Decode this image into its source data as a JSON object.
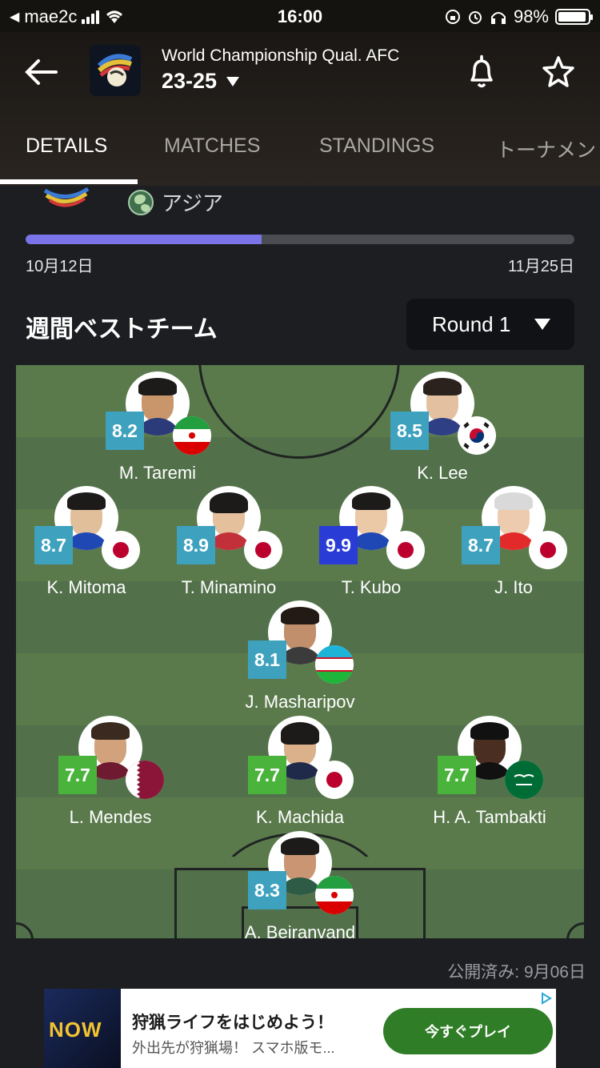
{
  "status_bar": {
    "carrier": "mae2c",
    "time": "16:00",
    "battery": "98%"
  },
  "header": {
    "competition": "World Championship Qual. AFC",
    "season": "23-25",
    "tabs": [
      "DETAILS",
      "MATCHES",
      "STANDINGS",
      "トーナメン"
    ]
  },
  "info": {
    "region": "アジア",
    "start_date": "10月12日",
    "end_date": "11月25日",
    "progress": 0.43
  },
  "team_of_week": {
    "title": "週間ベストチーム",
    "round": "Round 1",
    "players": [
      {
        "name": "M. Taremi",
        "rating": "8.2",
        "flag": "iran-flag"
      },
      {
        "name": "K. Lee",
        "rating": "8.5",
        "flag": "south-korea-flag"
      },
      {
        "name": "K. Mitoma",
        "rating": "8.7",
        "flag": "japan-flag"
      },
      {
        "name": "T. Minamino",
        "rating": "8.9",
        "flag": "japan-flag"
      },
      {
        "name": "T. Kubo",
        "rating": "9.9",
        "flag": "japan-flag"
      },
      {
        "name": "J. Ito",
        "rating": "8.7",
        "flag": "japan-flag"
      },
      {
        "name": "J. Masharipov",
        "rating": "8.1",
        "flag": "uzbekistan-flag"
      },
      {
        "name": "L. Mendes",
        "rating": "7.7",
        "flag": "qatar-flag"
      },
      {
        "name": "K. Machida",
        "rating": "7.7",
        "flag": "japan-flag"
      },
      {
        "name": "H. A. Tambakti",
        "rating": "7.7",
        "flag": "saudi-arabia-flag"
      },
      {
        "name": "A. Beiranvand",
        "rating": "8.3",
        "flag": "iran-flag"
      }
    ],
    "published": "公開済み: 9月06日"
  },
  "ad": {
    "icon_text": "NOW",
    "title": "狩猟ライフをはじめよう！",
    "subtitle": "外出先が狩猟場！ スマホ版モ...",
    "button": "今すぐプレイ"
  },
  "colors": {
    "progress": "#7b74e8",
    "rating_default": "#3ea2be",
    "rating_top": "#2a3cd6",
    "rating_green": "#4ab33c",
    "ad_button": "#2f7d26"
  }
}
